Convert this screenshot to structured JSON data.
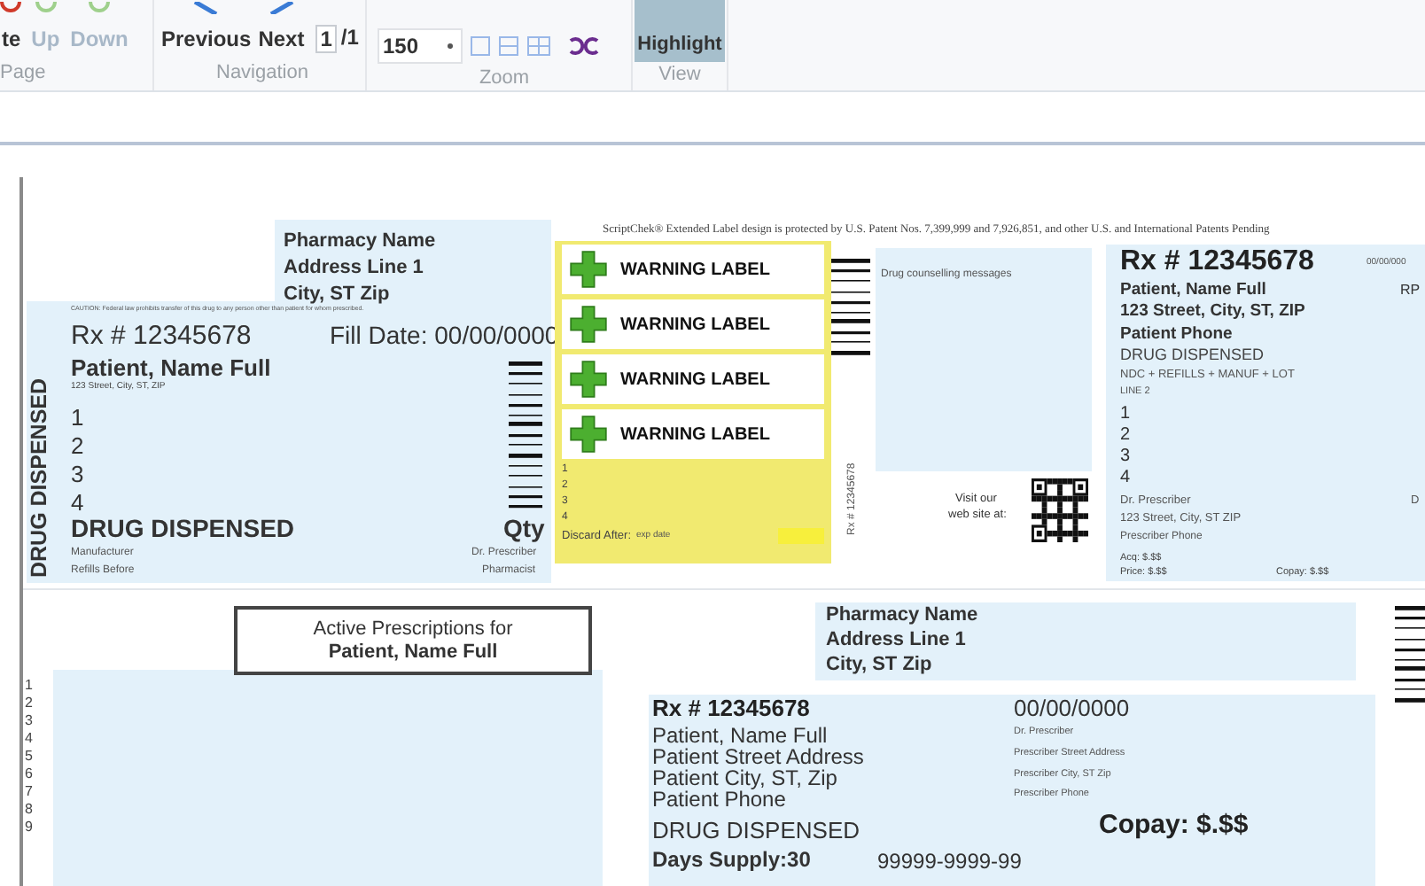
{
  "toolbar": {
    "page_group": {
      "label": "Page",
      "buttons": [
        {
          "label": "te",
          "disabled": false
        },
        {
          "label": "Up",
          "disabled": true
        },
        {
          "label": "Down",
          "disabled": true
        }
      ]
    },
    "navigation_group": {
      "label": "Navigation",
      "buttons": [
        {
          "label": "Previous",
          "disabled": false
        },
        {
          "label": "Next",
          "disabled": false
        }
      ],
      "page": "1",
      "page_total": "/1"
    },
    "zoom_group": {
      "label": "Zoom",
      "zoom": "150"
    },
    "view_group": {
      "label": "View",
      "buttons": [
        {
          "label": "Highlight",
          "selected": true
        }
      ]
    }
  },
  "patent_notice": "ScriptChek® Extended Label design is protected by U.S. Patent Nos. 7,399,999 and 7,926,851, and other U.S. and International Patents Pending",
  "left_label": {
    "pharmacy": [
      "Pharmacy Name",
      "Address Line 1",
      "City, ST Zip"
    ],
    "caution": "CAUTION: Federal law prohibits transfer of this drug to any person other than patient for whom prescribed.",
    "rx": "Rx # 12345678",
    "fill_date": "Fill Date: 00/00/0000",
    "patient": "Patient, Name Full",
    "address": "123 Street, City, ST, ZIP",
    "lines": [
      "1",
      "2",
      "3",
      "4"
    ],
    "drug": "DRUG DISPENSED",
    "qty": "Qty",
    "manufacturer": "Manufacturer",
    "refills": "Refills Before",
    "prescriber": "Dr. Prescriber",
    "pharmacist": "Pharmacist",
    "side_text": "DRUG DISPENSED"
  },
  "warning_panel": {
    "labels": [
      "WARNING LABEL",
      "WARNING LABEL",
      "WARNING LABEL",
      "WARNING LABEL"
    ],
    "lines": [
      "1",
      "2",
      "3",
      "4"
    ],
    "discard_label": "Discard After:",
    "discard_value": "exp date"
  },
  "middle": {
    "rx_vertical": "Rx #  12345678",
    "counselling": "Drug counselling messages",
    "visit": [
      "Visit our",
      "web site at:"
    ]
  },
  "right_label": {
    "rx": "Rx # 12345678",
    "date": "00/00/000",
    "patient": "Patient, Name Full",
    "rp": "RP",
    "address": "123 Street, City, ST, ZIP",
    "phone": "Patient Phone",
    "drug": "DRUG DISPENSED",
    "ndc": "NDC + REFILLS + MANUF + LOT",
    "line2": "LINE 2",
    "lines": [
      "1",
      "2",
      "3",
      "4"
    ],
    "prescriber": "Dr. Prescriber",
    "prescriber_cut": "D",
    "prescriber_address": "123 Street, City, ST ZIP",
    "prescriber_phone": "Prescriber Phone",
    "acq": "Acq:  $.$$",
    "price": "Price:  $.$$",
    "copay": "Copay:  $.$$"
  },
  "active_list": {
    "title": [
      "Active Prescriptions for",
      "Patient, Name Full"
    ],
    "lines": [
      "1",
      "2",
      "3",
      "4",
      "5",
      "6",
      "7",
      "8",
      "9"
    ]
  },
  "receipt": {
    "pharmacy": [
      "Pharmacy Name",
      "Address Line 1",
      "City, ST Zip"
    ],
    "rx": "Rx # 12345678",
    "patient": [
      "Patient, Name Full",
      "Patient Street Address",
      "Patient City, ST, Zip",
      "Patient Phone"
    ],
    "date": "00/00/0000",
    "prescriber": [
      "Dr. Prescriber",
      "Prescriber Street Address",
      "Prescriber City, ST Zip",
      "Prescriber Phone"
    ],
    "drug": "DRUG DISPENSED",
    "days_supply": "Days Supply:30",
    "ndc": "99999-9999-99",
    "copay": "Copay: $.$$"
  }
}
